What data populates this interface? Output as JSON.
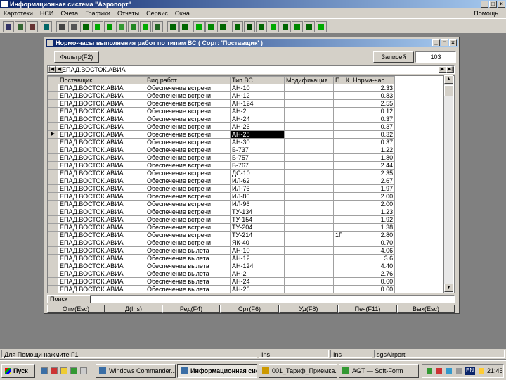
{
  "app": {
    "title": "Информационная система \"Аэропорт\"",
    "menu": [
      "Картотеки",
      "НСИ",
      "Счета",
      "Графики",
      "Отчеты",
      "Сервис",
      "Окна"
    ],
    "help": "Помощь"
  },
  "child": {
    "title": "Нормо-часы выполнения работ по типам ВС ( Сорт: 'Поставщик' )",
    "filter_label": "Фильтр(F2)",
    "records_label": "Записей",
    "records_count": "103",
    "current_value": "ЕПАД.ВОСТОК.АВИА",
    "columns": [
      "Поставщик",
      "Вид работ",
      "Тип ВС",
      "Модификация",
      "П",
      "К",
      "Норма-час"
    ],
    "rows": [
      [
        "ЕПАД.ВОСТОК.АВИА",
        "Обеспечение встречи",
        "АН-10",
        "",
        "",
        "",
        "2.33"
      ],
      [
        "ЕПАД.ВОСТОК.АВИА",
        "Обеспечение встречи",
        "АН-12",
        "",
        "",
        "",
        "0.83"
      ],
      [
        "ЕПАД.ВОСТОК.АВИА",
        "Обеспечение встречи",
        "АН-124",
        "",
        "",
        "",
        "2.55"
      ],
      [
        "ЕПАД.ВОСТОК.АВИА",
        "Обеспечение встречи",
        "АН-2",
        "",
        "",
        "",
        "0.12"
      ],
      [
        "ЕПАД.ВОСТОК.АВИА",
        "Обеспечение встречи",
        "АН-24",
        "",
        "",
        "",
        "0.37"
      ],
      [
        "ЕПАД.ВОСТОК.АВИА",
        "Обеспечение встречи",
        "АН-26",
        "",
        "",
        "",
        "0.37"
      ],
      [
        "ЕПАД.ВОСТОК.АВИА",
        "Обеспечение встречи",
        "АН-28",
        "",
        "",
        "",
        "0.32"
      ],
      [
        "ЕПАД.ВОСТОК.АВИА",
        "Обеспечение встречи",
        "АН-30",
        "",
        "",
        "",
        "0.37"
      ],
      [
        "ЕПАД.ВОСТОК.АВИА",
        "Обеспечение встречи",
        "Б-737",
        "",
        "",
        "",
        "1.22"
      ],
      [
        "ЕПАД.ВОСТОК.АВИА",
        "Обеспечение встречи",
        "Б-757",
        "",
        "",
        "",
        "1.80"
      ],
      [
        "ЕПАД.ВОСТОК.АВИА",
        "Обеспечение встречи",
        "Б-767",
        "",
        "",
        "",
        "2.44"
      ],
      [
        "ЕПАД.ВОСТОК.АВИА",
        "Обеспечение встречи",
        "ДС-10",
        "",
        "",
        "",
        "2.35"
      ],
      [
        "ЕПАД.ВОСТОК.АВИА",
        "Обеспечение встречи",
        "ИЛ-62",
        "",
        "",
        "",
        "2.67"
      ],
      [
        "ЕПАД.ВОСТОК.АВИА",
        "Обеспечение встречи",
        "ИЛ-76",
        "",
        "",
        "",
        "1.97"
      ],
      [
        "ЕПАД.ВОСТОК.АВИА",
        "Обеспечение встречи",
        "ИЛ-86",
        "",
        "",
        "",
        "2.00"
      ],
      [
        "ЕПАД.ВОСТОК.АВИА",
        "Обеспечение встречи",
        "ИЛ-96",
        "",
        "",
        "",
        "2.00"
      ],
      [
        "ЕПАД.ВОСТОК.АВИА",
        "Обеспечение встречи",
        "ТУ-134",
        "",
        "",
        "",
        "1.23"
      ],
      [
        "ЕПАД.ВОСТОК.АВИА",
        "Обеспечение встречи",
        "ТУ-154",
        "",
        "",
        "",
        "1.92"
      ],
      [
        "ЕПАД.ВОСТОК.АВИА",
        "Обеспечение встречи",
        "ТУ-204",
        "",
        "",
        "",
        "1.38"
      ],
      [
        "ЕПАД.ВОСТОК.АВИА",
        "Обеспечение встречи",
        "ТУ-214",
        "",
        "1Г",
        "",
        "2.80"
      ],
      [
        "ЕПАД.ВОСТОК.АВИА",
        "Обеспечение встречи",
        "ЯК-40",
        "",
        "",
        "",
        "0.70"
      ],
      [
        "ЕПАД.ВОСТОК.АВИА",
        "Обеспечение вылета",
        "АН-10",
        "",
        "",
        "",
        "4.06"
      ],
      [
        "ЕПАД.ВОСТОК.АВИА",
        "Обеспечение вылета",
        "АН-12",
        "",
        "",
        "",
        "3.6"
      ],
      [
        "ЕПАД.ВОСТОК.АВИА",
        "Обеспечение вылета",
        "АН-124",
        "",
        "",
        "",
        "4.40"
      ],
      [
        "ЕПАД.ВОСТОК.АВИА",
        "Обеспечение вылета",
        "АН-2",
        "",
        "",
        "",
        "2.76"
      ],
      [
        "ЕПАД.ВОСТОК.АВИА",
        "Обеспечение вылета",
        "АН-24",
        "",
        "",
        "",
        "0.60"
      ],
      [
        "ЕПАД.ВОСТОК.АВИА",
        "Обеспечение вылета",
        "АН-26",
        "",
        "",
        "",
        "0.60"
      ]
    ],
    "selected_row": 6,
    "search_label": "Поиск",
    "buttons": [
      "Отм(Esc)",
      "Д(Ins)",
      "Ред(F4)",
      "Срт(F6)",
      "Уд(F8)",
      "Печ(F11)",
      "Вых(Esc)"
    ]
  },
  "statusbar": {
    "hint": "Для Помощи нажмите F1",
    "cells": [
      "Ins",
      "Ins",
      "sgsAirport"
    ]
  },
  "taskbar": {
    "start": "Пуск",
    "tasks": [
      "Windows Commander...",
      "Информационная сис...",
      "001_Тариф_Приемка...",
      "AGT — Soft-Form"
    ],
    "active_task": 1,
    "tray_lang": "EN",
    "tray_clock": "21:45"
  },
  "colors": {
    "title_from": "#0a246a",
    "title_to": "#a6caf0",
    "face": "#d4d0c8",
    "desktop": "#808080"
  }
}
